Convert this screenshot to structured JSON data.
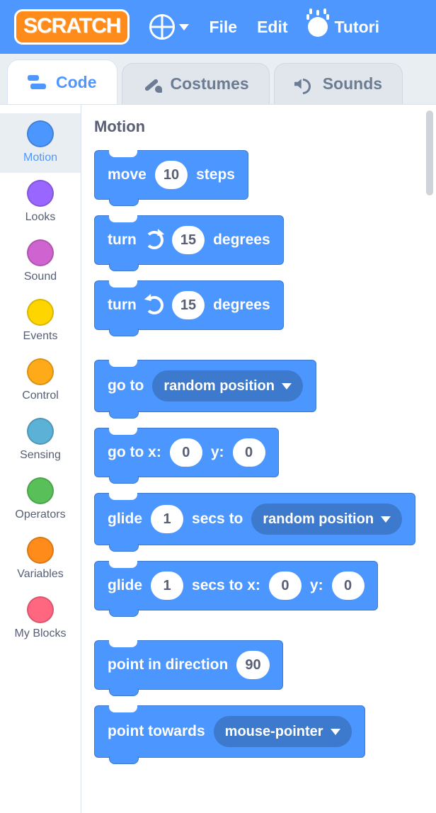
{
  "brand": "SCRATCH",
  "menu": {
    "file": "File",
    "edit": "Edit",
    "tutorials": "Tutori"
  },
  "tabs": {
    "code": "Code",
    "costumes": "Costumes",
    "sounds": "Sounds"
  },
  "categories": [
    {
      "name": "Motion",
      "color": "#4c97ff"
    },
    {
      "name": "Looks",
      "color": "#9966ff"
    },
    {
      "name": "Sound",
      "color": "#cf63cf"
    },
    {
      "name": "Events",
      "color": "#ffd500"
    },
    {
      "name": "Control",
      "color": "#ffab19"
    },
    {
      "name": "Sensing",
      "color": "#5cb1d6"
    },
    {
      "name": "Operators",
      "color": "#59c059"
    },
    {
      "name": "Variables",
      "color": "#ff8c1a"
    },
    {
      "name": "My Blocks",
      "color": "#ff6680"
    }
  ],
  "paletteTitle": "Motion",
  "blocks": {
    "move": {
      "pre": "move",
      "val": "10",
      "post": "steps"
    },
    "turnCW": {
      "pre": "turn",
      "val": "15",
      "post": "degrees"
    },
    "turnCCW": {
      "pre": "turn",
      "val": "15",
      "post": "degrees"
    },
    "goto": {
      "pre": "go to",
      "dd": "random position"
    },
    "gotoXY": {
      "pre": "go to x:",
      "x": "0",
      "mid": "y:",
      "y": "0"
    },
    "glideTo": {
      "pre": "glide",
      "secs": "1",
      "mid": "secs to",
      "dd": "random position"
    },
    "glideXY": {
      "pre": "glide",
      "secs": "1",
      "mid": "secs to x:",
      "x": "0",
      "mid2": "y:",
      "y": "0"
    },
    "pointDir": {
      "pre": "point in direction",
      "val": "90"
    },
    "pointTow": {
      "pre": "point towards",
      "dd": "mouse-pointer"
    }
  }
}
